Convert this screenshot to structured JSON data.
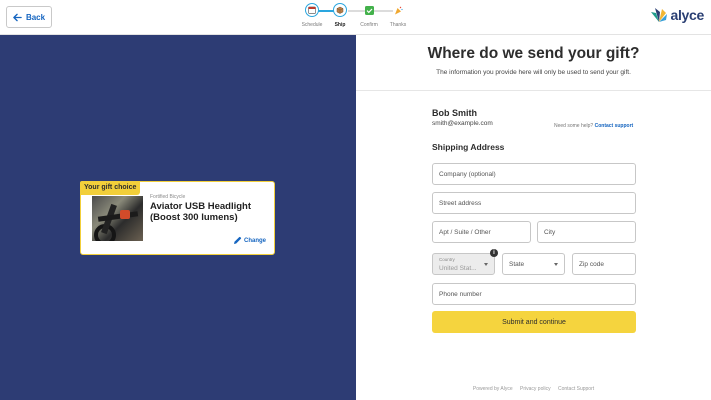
{
  "header": {
    "back_label": "Back",
    "logo_text": "alyce",
    "steps": [
      {
        "label": "Schedule",
        "icon": "calendar-icon",
        "state": "done"
      },
      {
        "label": "Ship",
        "icon": "box-icon",
        "state": "active"
      },
      {
        "label": "Confirm",
        "icon": "check-icon",
        "state": "future"
      },
      {
        "label": "Thanks",
        "icon": "party-icon",
        "state": "future"
      }
    ]
  },
  "gift": {
    "tag": "Your gift choice",
    "brand": "Fortified Bicycle",
    "title": "Aviator USB Headlight (Boost 300 lumens)",
    "change_label": "Change"
  },
  "form": {
    "title": "Where do we send your gift?",
    "subtitle": "The information you provide here will only be used to send your gift.",
    "recipient_name": "Bob Smith",
    "recipient_email": "smith@example.com",
    "help_text": "Need some help?",
    "help_link": "Contact support",
    "section_title": "Shipping Address",
    "company_placeholder": "Company (optional)",
    "street_placeholder": "Street address",
    "apt_placeholder": "Apt / Suite / Other",
    "city_placeholder": "City",
    "country_label": "Country",
    "country_value": "United Stat...",
    "state_placeholder": "State",
    "zip_placeholder": "Zip code",
    "phone_placeholder": "Phone number",
    "submit_label": "Submit and continue"
  },
  "footer": {
    "links": [
      "Powered by Alyce",
      "Privacy policy",
      "Contact Support"
    ]
  },
  "colors": {
    "left_panel_bg": "#2d3c74",
    "accent_yellow": "#f5d43e",
    "link_blue": "#1565c0",
    "stepper_blue": "#2aa6df"
  }
}
